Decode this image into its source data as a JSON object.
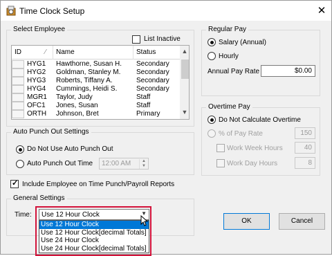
{
  "window": {
    "title": "Time Clock Setup",
    "close_glyph": "✕"
  },
  "select_employee": {
    "legend": "Select Employee",
    "list_inactive_label": "List Inactive",
    "list_inactive_checked": false,
    "columns": [
      "ID",
      "Name",
      "Status"
    ],
    "rows": [
      {
        "id": "HYG1",
        "name": "Hawthorne, Susan H.",
        "status": "Secondary"
      },
      {
        "id": "HYG2",
        "name": "Goldman, Stanley M.",
        "status": "Secondary"
      },
      {
        "id": "HYG3",
        "name": "Roberts, Tiffany A.",
        "status": "Secondary"
      },
      {
        "id": "HYG4",
        "name": "Cummings, Heidi S.",
        "status": "Secondary"
      },
      {
        "id": "MGR1",
        "name": "Taylor, Judy",
        "status": "Staff"
      },
      {
        "id": "OFC1",
        "name": "Jones, Susan",
        "status": "Staff"
      },
      {
        "id": "ORTH",
        "name": "Johnson, Bret",
        "status": "Primary"
      }
    ]
  },
  "auto_punch": {
    "legend": "Auto Punch Out Settings",
    "option_none": "Do Not Use Auto Punch Out",
    "option_time": "Auto Punch Out Time",
    "time_value": "12:00 AM",
    "selected": "none"
  },
  "include_employee": {
    "label": "Include Employee on Time Punch/Payroll Reports",
    "checked": true
  },
  "general": {
    "legend": "General Settings",
    "time_label": "Time:",
    "time_value": "Use 12 Hour Clock",
    "options": [
      "Use 12 Hour Clock",
      "Use 12 Hour Clock[decimal Totals]",
      "Use 24 Hour Clock",
      "Use 24 Hour Clock[decimal Totals]"
    ],
    "highlighted_index": 0
  },
  "regular_pay": {
    "legend": "Regular Pay",
    "option_salary": "Salary (Annual)",
    "option_hourly": "Hourly",
    "selected": "salary",
    "rate_label": "Annual Pay Rate",
    "rate_value": "$0.00"
  },
  "overtime_pay": {
    "legend": "Overtime Pay",
    "option_none": "Do Not Calculate Overtime",
    "option_percent": "% of Pay Rate",
    "percent_value": "150",
    "work_week_label": "Work Week Hours",
    "work_week_value": "40",
    "work_day_label": "Work Day Hours",
    "work_day_value": "8"
  },
  "buttons": {
    "ok": "OK",
    "cancel": "Cancel"
  },
  "colors": {
    "selection": "#0078d7",
    "highlight_frame": "#d2123a"
  }
}
